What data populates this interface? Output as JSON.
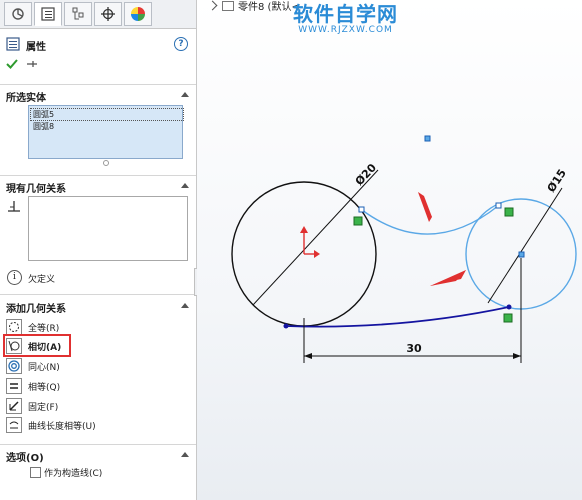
{
  "tabs": [
    {
      "icon": "feature-manager-icon"
    },
    {
      "icon": "property-manager-icon"
    },
    {
      "icon": "configuration-manager-icon"
    },
    {
      "icon": "dimxpert-icon"
    },
    {
      "icon": "display-manager-icon"
    }
  ],
  "property": {
    "title": "属性",
    "help_icon": "help-icon",
    "ok_icon": "ok-check-icon",
    "pin_icon": "pin-icon"
  },
  "selected_entities": {
    "header": "所选实体",
    "items": [
      "圆弧5",
      "圆弧8"
    ]
  },
  "existing_relations": {
    "header": "現有几何关系",
    "status": "欠定义"
  },
  "add_relations": {
    "header": "添加几何关系",
    "items": [
      {
        "label": "全等(R)",
        "icon": "coradial-icon"
      },
      {
        "label": "相切(A)",
        "icon": "tangent-icon"
      },
      {
        "label": "同心(N)",
        "icon": "concentric-icon"
      },
      {
        "label": "相等(Q)",
        "icon": "equal-icon"
      },
      {
        "label": "固定(F)",
        "icon": "fix-icon"
      },
      {
        "label": "曲线长度相等(U)",
        "icon": "equal-curve-length-icon"
      }
    ],
    "highlighted": "相切(A)"
  },
  "options": {
    "header": "选项(O)",
    "construction_label": "作为构造线(C)"
  },
  "graphics": {
    "breadcrumb": "零件8 (默认<",
    "watermark_title": "软件自学网",
    "watermark_url": "WWW.RJZXW.COM",
    "dim_large_circle": "Ø20",
    "dim_small_circle": "Ø15",
    "dim_distance": "30"
  },
  "colors": {
    "accent_blue": "#2a8bd6",
    "highlight_red": "#e03030",
    "sketch_blue": "#5aa8e6",
    "line_dark_blue": "#1414a0"
  }
}
